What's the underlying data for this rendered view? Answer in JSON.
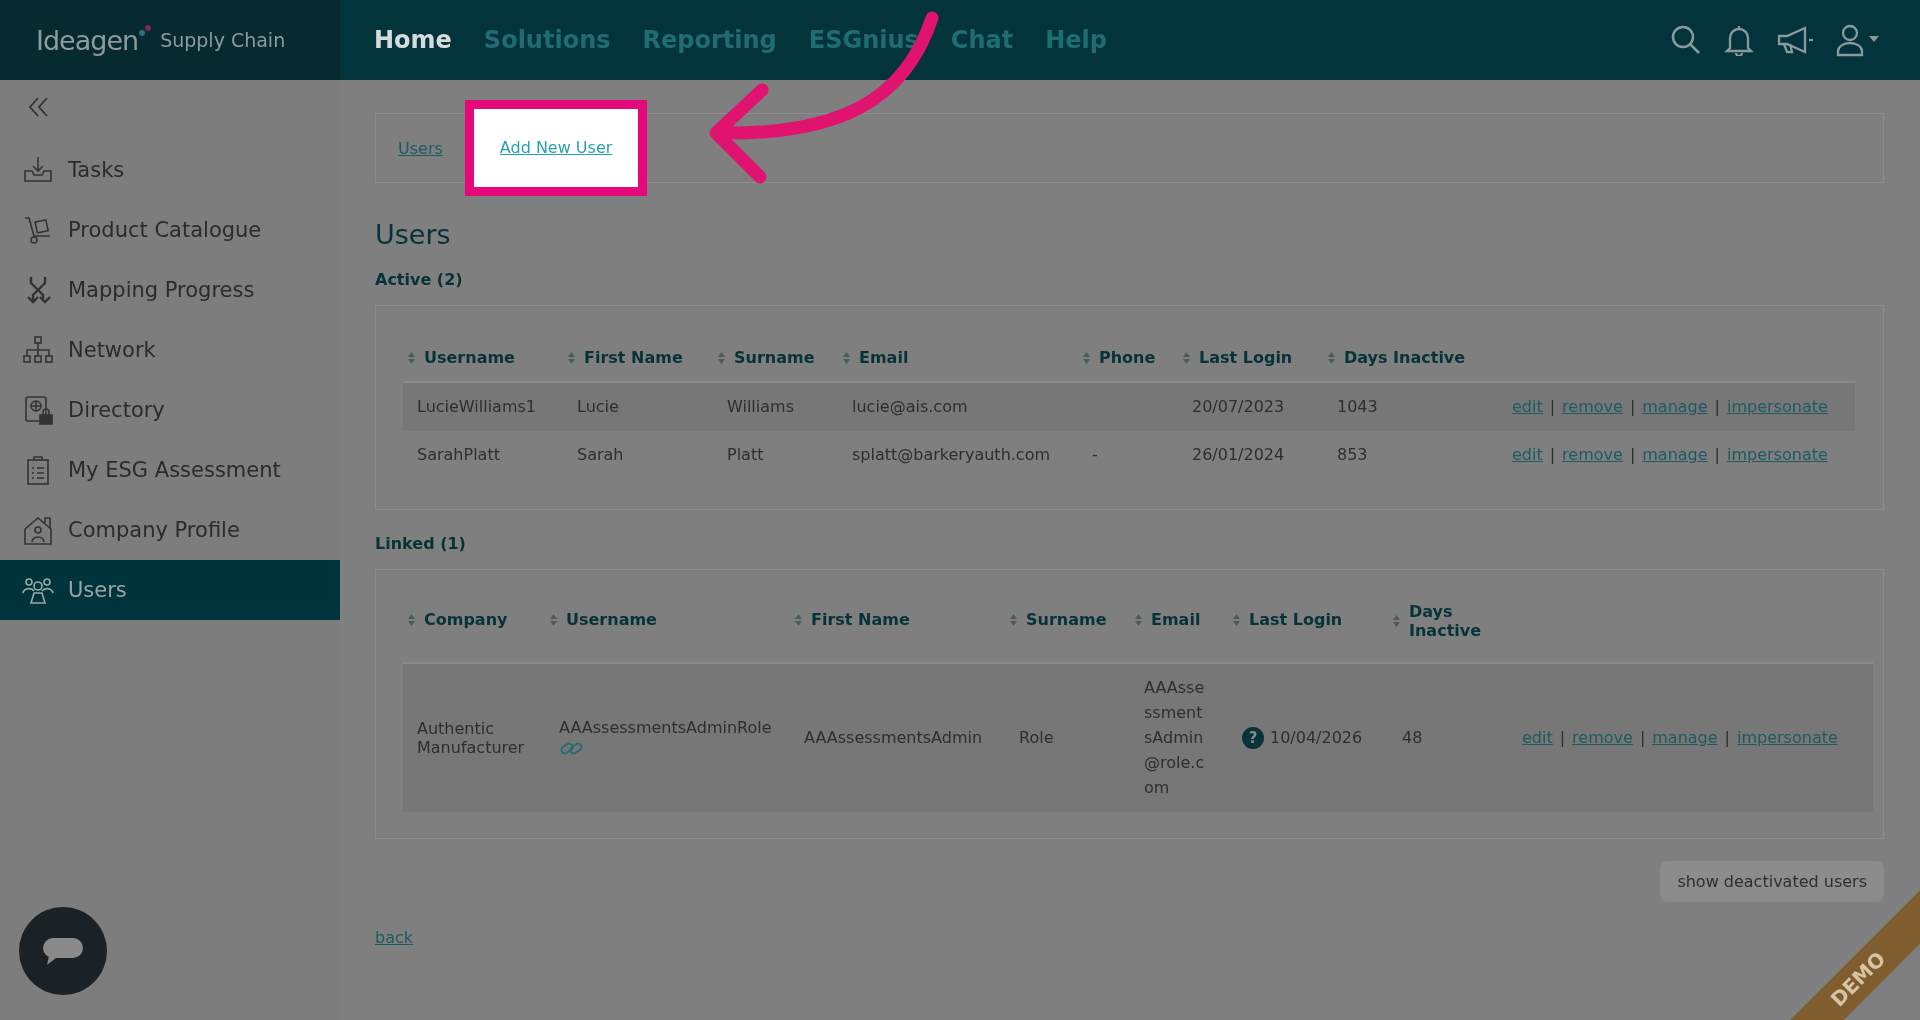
{
  "header": {
    "brand": "Ideagen",
    "product": "Supply Chain",
    "nav": [
      {
        "label": "Home",
        "selected": true
      },
      {
        "label": "Solutions",
        "selected": false
      },
      {
        "label": "Reporting",
        "selected": false
      },
      {
        "label": "ESGnius",
        "selected": false
      },
      {
        "label": "Chat",
        "selected": false
      },
      {
        "label": "Help",
        "selected": false
      }
    ]
  },
  "sidebar": {
    "items": [
      {
        "label": "Tasks",
        "selected": false
      },
      {
        "label": "Product Catalogue",
        "selected": false
      },
      {
        "label": "Mapping Progress",
        "selected": false
      },
      {
        "label": "Network",
        "selected": false
      },
      {
        "label": "Directory",
        "selected": false
      },
      {
        "label": "My ESG Assessment",
        "selected": false
      },
      {
        "label": "Company Profile",
        "selected": false
      },
      {
        "label": "Users",
        "selected": true
      }
    ]
  },
  "breadcrumb": [
    {
      "label": "Users",
      "highlighted": false
    },
    {
      "label": "Add New User",
      "highlighted": true
    }
  ],
  "title": "Users",
  "active": {
    "heading": "Active (2)",
    "separator": "|",
    "columns": [
      "Username",
      "First Name",
      "Surname",
      "Email",
      "Phone",
      "Last Login",
      "Days Inactive"
    ],
    "rows": [
      {
        "cells": [
          "LucieWilliams1",
          "Lucie",
          "Williams",
          "lucie@ais.com",
          "",
          "20/07/2023",
          "1043"
        ],
        "actions": [
          "edit",
          "remove",
          "manage",
          "impersonate"
        ]
      },
      {
        "cells": [
          "SarahPlatt",
          "Sarah",
          "Platt",
          "splatt@barkeryauth.com",
          "-",
          "26/01/2024",
          "853"
        ],
        "actions": [
          "edit",
          "remove",
          "manage",
          "impersonate"
        ]
      }
    ]
  },
  "linked": {
    "heading": "Linked (1)",
    "separator": "|",
    "columns": [
      "Company",
      "Username",
      "First Name",
      "Surname",
      "Email",
      "Last Login",
      "Days Inactive"
    ],
    "rows": [
      {
        "company": "Authentic Manufacturer",
        "username": "AAAssessmentsAdminRole",
        "first_name": "AAAssessmentsAdmin",
        "surname": "Role",
        "email": "AAAssessmentsAdmin@role.com",
        "login_hint": "?",
        "last_login": "10/04/2026",
        "days_inactive": "48",
        "actions": [
          "edit",
          "remove",
          "manage",
          "impersonate"
        ]
      }
    ]
  },
  "show_deactivated": "show deactivated users",
  "back": "back",
  "ribbon": "DEMO"
}
